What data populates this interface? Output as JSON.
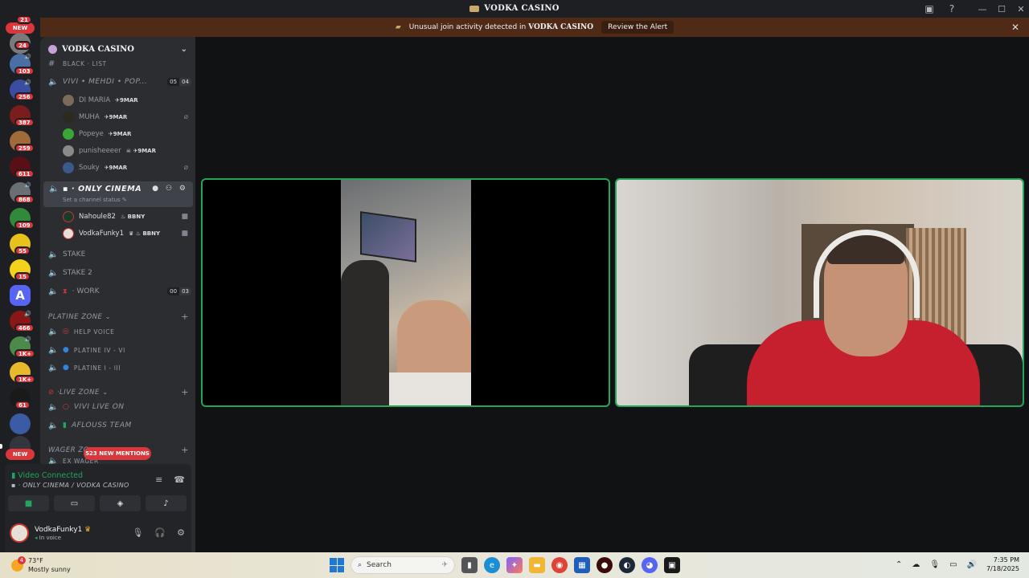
{
  "window": {
    "title": "VODKA CASINO"
  },
  "alert": {
    "text": "Unusual join activity detected in",
    "server": "VODKA CASINO",
    "button": "Review the Alert"
  },
  "rail": {
    "top_pill": "NEW",
    "top_badge": "21",
    "badges": [
      "24",
      "103",
      "256",
      "387",
      "259",
      "611",
      "868",
      "109",
      "55",
      "15",
      "466",
      "1K+",
      "1K+",
      "61"
    ],
    "bottom_pill": "NEW",
    "letter_server": "A"
  },
  "sidebar": {
    "guild_name": "VODKA CASINO",
    "partial_channel": "BLACK · LIST",
    "channels": [
      {
        "name": "VIVI • MEHDI • POP...",
        "counts": [
          "05",
          "04"
        ]
      }
    ],
    "users_group1": [
      {
        "name": "DI MARIA",
        "tag": "9MAR"
      },
      {
        "name": "MUHA",
        "tag": "9MAR"
      },
      {
        "name": "Popeye",
        "tag": "9MAR"
      },
      {
        "name": "punisheeeer",
        "tag": "9MAR"
      },
      {
        "name": "Souky",
        "tag": "9MAR"
      }
    ],
    "active_channel": {
      "name": "ONLY CINEMA",
      "status": "Set a channel status"
    },
    "users_group2": [
      {
        "name": "Nahoule82",
        "tag": "BBNY"
      },
      {
        "name": "VodkaFunky1",
        "tag": "BBNY"
      }
    ],
    "stake": "STAKE",
    "stake2": "STAKE 2",
    "work": {
      "name": "WORK",
      "counts": [
        "00",
        "03"
      ]
    },
    "cat_platine": "PLATINE ZONE",
    "platine_channels": [
      "HELP VOICE",
      "PLATINE IV - VI",
      "PLATINE I - III"
    ],
    "cat_live": "LIVE ZONE",
    "live_channels": [
      "VIVI LIVE ON",
      "AFLOUSS TEAM"
    ],
    "cat_wager": "WAGER ZO",
    "wager_partial": "EX WAGER",
    "mentions": "523 NEW MENTIONS"
  },
  "voice": {
    "status": "Video Connected",
    "channel": "ONLY CINEMA / VODKA CASINO"
  },
  "me": {
    "name": "VodkaFunky1",
    "status": "In voice"
  },
  "taskbar": {
    "temp": "73°F",
    "weather": "Mostly sunny",
    "weather_badge": "4",
    "search": "Search",
    "time": "7:35 PM",
    "date": "7/18/2025"
  },
  "colors": {
    "accent_green": "#23a55a",
    "badge_red": "#da373c",
    "alert_bg": "#4e2a17"
  }
}
